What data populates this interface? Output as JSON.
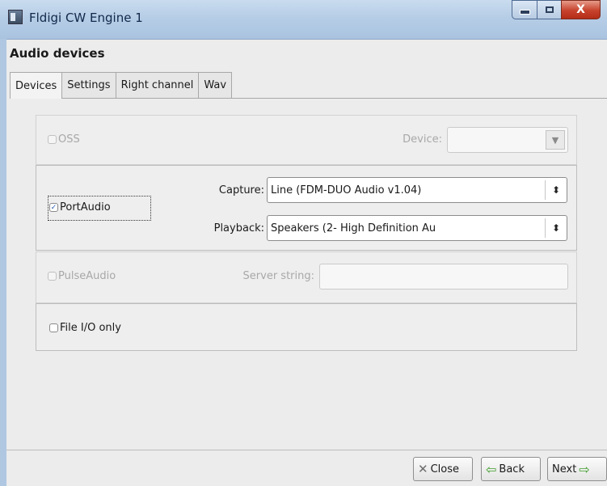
{
  "window": {
    "title": "Fldigi CW Engine 1",
    "close_glyph": "X"
  },
  "page": {
    "heading": "Audio devices"
  },
  "tabs": [
    {
      "label": "Devices",
      "active": true
    },
    {
      "label": "Settings",
      "active": false
    },
    {
      "label": "Right channel",
      "active": false
    },
    {
      "label": "Wav",
      "active": false
    }
  ],
  "oss": {
    "label": "OSS",
    "checked": false,
    "device_label": "Device:",
    "device_value": ""
  },
  "portaudio": {
    "label": "PortAudio",
    "checked": true,
    "capture_label": "Capture:",
    "capture_value": "Line (FDM-DUO Audio v1.04)",
    "playback_label": "Playback:",
    "playback_value": "Speakers (2- High Definition Au"
  },
  "pulseaudio": {
    "label": "PulseAudio",
    "checked": false,
    "server_label": "Server string:",
    "server_value": ""
  },
  "file_io": {
    "label": "File I/O only",
    "checked": false
  },
  "buttons": {
    "close": "Close",
    "back": "Back",
    "next": "Next"
  },
  "icons": {
    "check": "✓",
    "spin": "⬍",
    "dropdown": "▼",
    "close": "✕",
    "back_arrow": "⇦",
    "next_arrow": "⇨"
  }
}
